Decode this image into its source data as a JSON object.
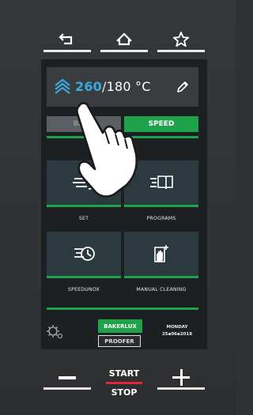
{
  "nav": {
    "back_icon": "back-arrow-icon",
    "home_icon": "home-icon",
    "favorite_icon": "star-icon"
  },
  "temperature": {
    "setpoint": "260",
    "separator": "/",
    "target": "180 °C",
    "icon": "speed-chevrons-icon",
    "edit_icon": "pencil-icon"
  },
  "modes": {
    "bake": "BAKE",
    "speed": "SPEED",
    "active": "speed"
  },
  "tiles": [
    {
      "label": "SET",
      "icon": "steam-fan-icon"
    },
    {
      "label": "PROGRAMS",
      "icon": "book-icon"
    },
    {
      "label": "SPEEDUNOX",
      "icon": "speed-clock-icon"
    },
    {
      "label": "MANUAL CLEANING",
      "icon": "cleaning-hand-icon"
    }
  ],
  "footer": {
    "gear_icon": "settings-gear-icon",
    "bakerlux": "BAKERLUX",
    "proofer": "PROOFER",
    "day": "MONDAY",
    "date": "25▪06▪2018"
  },
  "bottom": {
    "minus_icon": "minus-icon",
    "start": "START",
    "stop": "STOP",
    "plus_icon": "plus-icon"
  },
  "colors": {
    "accent_green": "#1fa34a",
    "accent_blue": "#39a9e0",
    "start_red": "#e0263a"
  }
}
